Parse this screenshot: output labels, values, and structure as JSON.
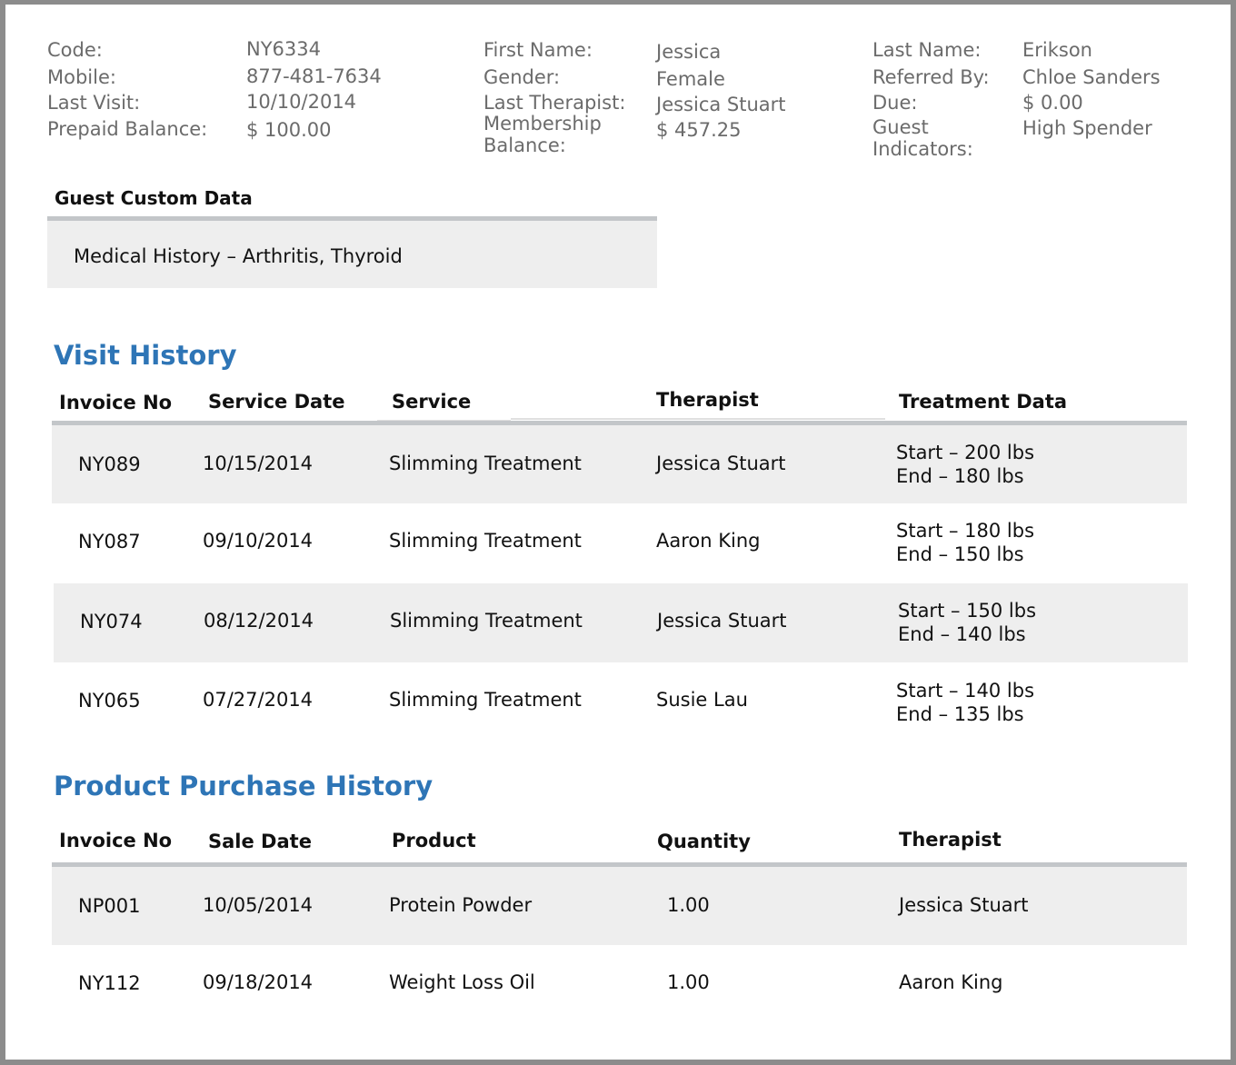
{
  "guest": {
    "code_label": "Code:",
    "code": "NY6334",
    "mobile_label": "Mobile:",
    "mobile": "877-481-7634",
    "last_visit_label": "Last Visit:",
    "last_visit": "10/10/2014",
    "prepaid_label": "Prepaid Balance:",
    "prepaid": "$ 100.00",
    "first_name_label": "First Name:",
    "first_name": "Jessica",
    "gender_label": "Gender:",
    "gender": "Female",
    "last_therapist_label": "Last Therapist:",
    "last_therapist": "Jessica Stuart",
    "membership_label_1": "Membership",
    "membership_label_2": "Balance:",
    "membership": "$ 457.25",
    "last_name_label": "Last Name:",
    "last_name": "Erikson",
    "referred_label": "Referred By:",
    "referred": "Chloe Sanders",
    "due_label": "Due:",
    "due": "$ 0.00",
    "indicators_label_1": "Guest",
    "indicators_label_2": "Indicators:",
    "indicators": "High Spender"
  },
  "custom_data": {
    "title": "Guest Custom Data",
    "text": "Medical History – Arthritis, Thyroid"
  },
  "visit_history": {
    "title": "Visit History",
    "headers": [
      "Invoice No",
      "Service Date",
      "Service",
      "Therapist",
      "Treatment Data"
    ],
    "rows": [
      {
        "invoice": "NY089",
        "date": "10/15/2014",
        "service": "Slimming Treatment",
        "therapist": "Jessica Stuart",
        "start": "Start – 200 lbs",
        "end": "End – 180 lbs"
      },
      {
        "invoice": "NY087",
        "date": "09/10/2014",
        "service": "Slimming Treatment",
        "therapist": "Aaron King",
        "start": "Start – 180 lbs",
        "end": "End – 150 lbs"
      },
      {
        "invoice": "NY074",
        "date": "08/12/2014",
        "service": "Slimming Treatment",
        "therapist": "Jessica Stuart",
        "start": "Start – 150 lbs",
        "end": "End – 140 lbs"
      },
      {
        "invoice": "NY065",
        "date": "07/27/2014",
        "service": "Slimming Treatment",
        "therapist": "Susie Lau",
        "start": "Start – 140 lbs",
        "end": "End – 135 lbs"
      }
    ]
  },
  "product_history": {
    "title": "Product Purchase History",
    "headers": [
      "Invoice No",
      "Sale Date",
      "Product",
      "Quantity",
      "Therapist"
    ],
    "rows": [
      {
        "invoice": "NP001",
        "date": "10/05/2014",
        "product": "Protein Powder",
        "quantity": "1.00",
        "therapist": "Jessica Stuart"
      },
      {
        "invoice": "NY112",
        "date": "09/18/2014",
        "product": "Weight Loss Oil",
        "quantity": "1.00",
        "therapist": "Aaron King"
      }
    ]
  },
  "colors": {
    "accent": "#2e75b6",
    "row_shade": "#eeeeee",
    "rule": "#c3c6c9",
    "label_text": "#6b6b6b"
  }
}
